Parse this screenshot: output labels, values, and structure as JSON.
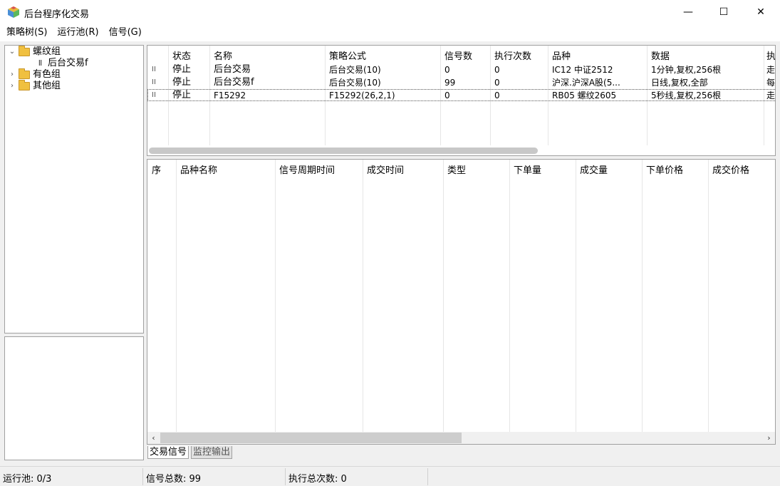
{
  "window": {
    "title": "后台程序化交易",
    "minimize_glyph": "—",
    "maximize_glyph": "☐",
    "close_glyph": "✕"
  },
  "menu": {
    "items": [
      "策略树(S)",
      "运行池(R)",
      "信号(G)"
    ]
  },
  "tree": {
    "groups": [
      {
        "label": "螺纹组",
        "expanded": true,
        "children": [
          {
            "label": "后台交易f",
            "status_glyph": "II"
          }
        ]
      },
      {
        "label": "有色组",
        "expanded": false
      },
      {
        "label": "其他组",
        "expanded": false
      }
    ],
    "expanded_glyph": "⌄",
    "collapsed_glyph": "›"
  },
  "strategy_grid": {
    "headers": [
      "状态",
      "名称",
      "策略公式",
      "信号数",
      "执行次数",
      "品种",
      "数据",
      "执"
    ],
    "rows": [
      {
        "glyph": "II",
        "status": "停止",
        "name": "后台交易",
        "formula": "后台交易(10)",
        "signals": "0",
        "runs": "0",
        "symbol": "IC12 中证2512",
        "data": "1分钟,复权,256根",
        "extra": "走"
      },
      {
        "glyph": "II",
        "status": "停止",
        "name": "后台交易f",
        "formula": "后台交易(10)",
        "signals": "99",
        "runs": "0",
        "symbol": "沪深.沪深A股(5...",
        "data": "日线,复权,全部",
        "extra": "每"
      },
      {
        "glyph": "II",
        "status": "停止",
        "name": "F15292",
        "formula": "F15292(26,2,1)",
        "signals": "0",
        "runs": "0",
        "symbol": "RB05 螺纹2605",
        "data": "5秒线,复权,256根",
        "extra": "走"
      }
    ]
  },
  "trade_grid": {
    "headers": [
      "序",
      "品种名称",
      "信号周期时间",
      "成交时间",
      "类型",
      "下单量",
      "成交量",
      "下单价格",
      "成交价格"
    ],
    "left_arrow": "‹",
    "right_arrow": "›"
  },
  "tabs": [
    "交易信号",
    "监控输出"
  ],
  "status": {
    "pool": "运行池: 0/3",
    "signals_total": "信号总数: 99",
    "runs_total": "执行总次数: 0"
  }
}
